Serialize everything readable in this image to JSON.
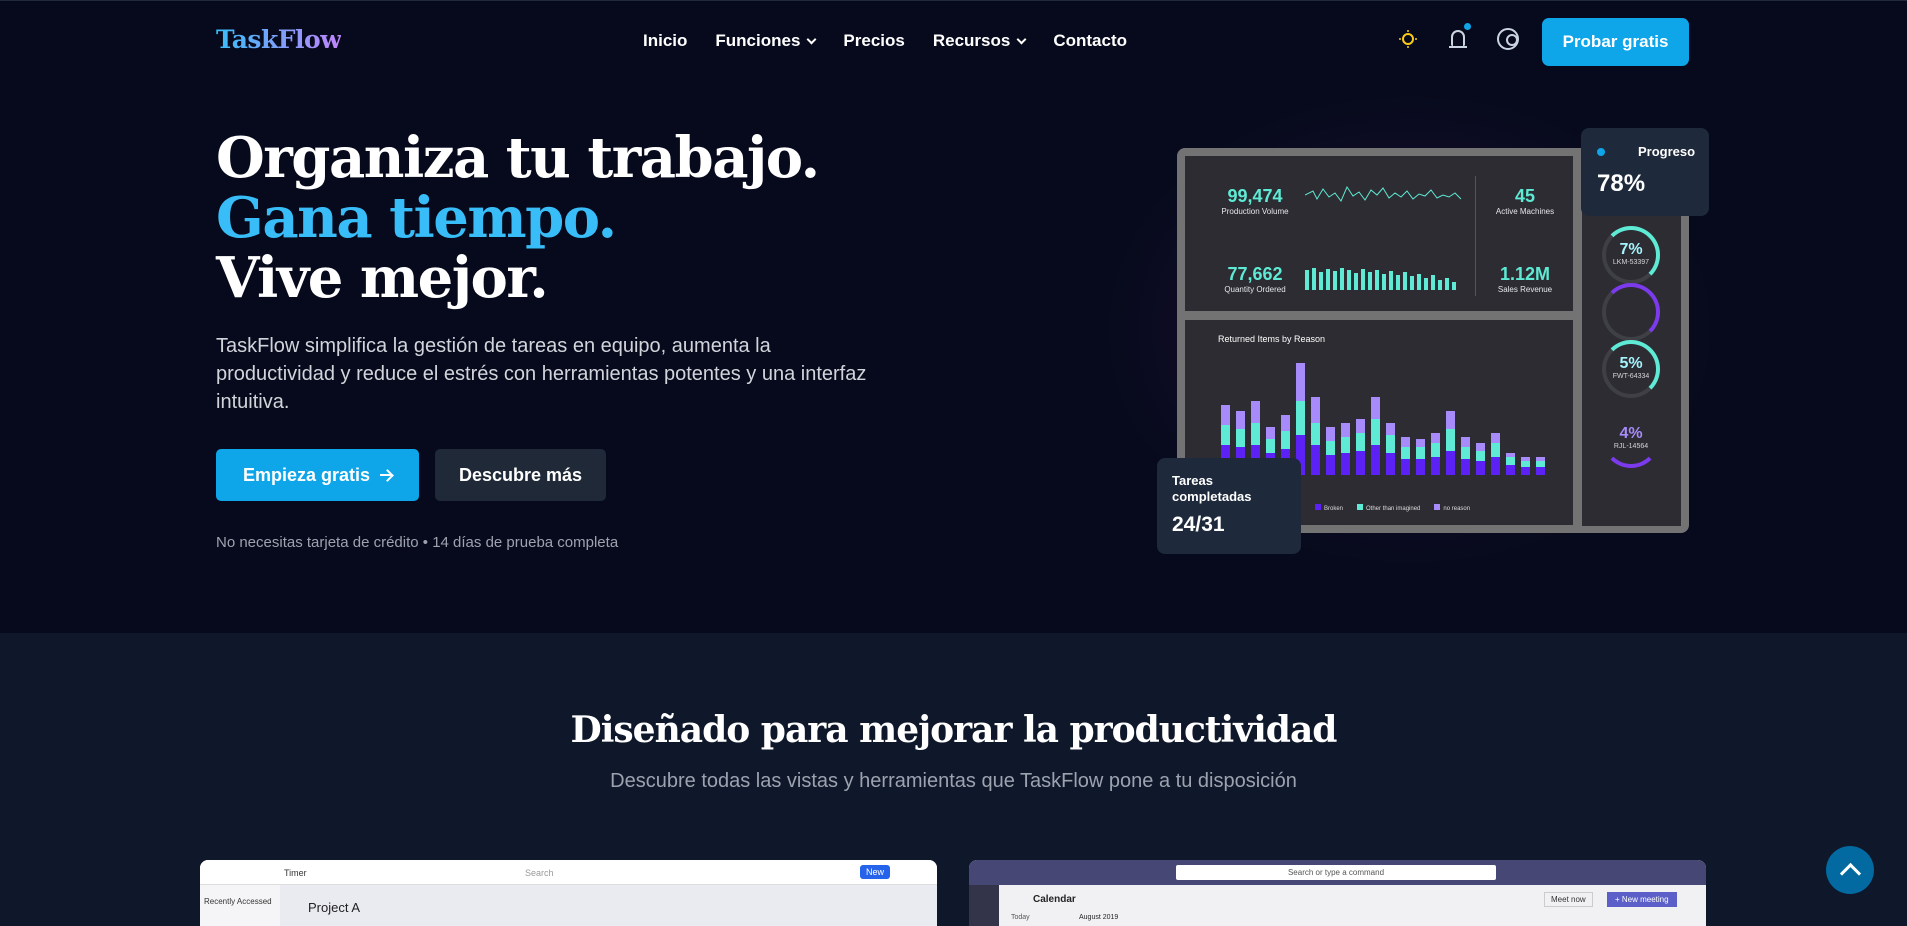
{
  "brand": {
    "name": "TaskFlow"
  },
  "nav": {
    "items": [
      {
        "label": "Inicio",
        "has_dropdown": false
      },
      {
        "label": "Funciones",
        "has_dropdown": true
      },
      {
        "label": "Precios",
        "has_dropdown": false
      },
      {
        "label": "Recursos",
        "has_dropdown": true
      },
      {
        "label": "Contacto",
        "has_dropdown": false
      }
    ],
    "icons": [
      "sun-icon",
      "bell-icon",
      "user-icon"
    ],
    "cta": "Probar gratis"
  },
  "hero": {
    "line1": "Organiza tu trabajo.",
    "line2": "Gana tiempo.",
    "line3": "Vive mejor.",
    "description": "TaskFlow simplifica la gestión de tareas en equipo, aumenta la productividad y reduce el estrés con herramientas potentes y una interfaz intuitiva.",
    "primary_button": "Empieza gratis",
    "secondary_button": "Descubre más",
    "note": "No necesitas tarjeta de crédito • 14 días de prueba completa"
  },
  "dashboard": {
    "kpis": [
      {
        "value": "99,474",
        "label": "Production Volume"
      },
      {
        "value": "45",
        "label": "Active Machines"
      },
      {
        "value": "77,662",
        "label": "Quantity Ordered"
      },
      {
        "value": "1.12M",
        "label": "Sales Revenue"
      }
    ],
    "chart_title": "Returned Items by Reason",
    "legend": [
      "Broken",
      "Other than imagined",
      "no reason"
    ],
    "gauges": [
      {
        "value": "7%",
        "label": "LKM-53397"
      },
      {
        "value": "5%",
        "label": "FWT-64334"
      },
      {
        "value": "4%",
        "label": "RJL-14564"
      }
    ],
    "progress_card": {
      "label": "Progreso",
      "value": "78%"
    },
    "tasks_card": {
      "label": "Tareas completadas",
      "value": "24/31"
    }
  },
  "features": {
    "title": "Diseñado para mejorar la productividad",
    "subtitle": "Descubre todas las vistas y herramientas que TaskFlow pone a tu disposición",
    "shot1": {
      "app_label": "Timer",
      "search": "Search",
      "new_label": "New",
      "project": "Project A",
      "sidebar": "Recently Accessed"
    },
    "shot2": {
      "search": "Search or type a command",
      "section": "Calendar",
      "meet": "Meet now",
      "new_meeting": "+ New meeting",
      "month": "August 2019",
      "today": "Today"
    }
  },
  "colors": {
    "accent": "#0ea5e9",
    "background": "#070a1c",
    "section": "#0f172a"
  }
}
